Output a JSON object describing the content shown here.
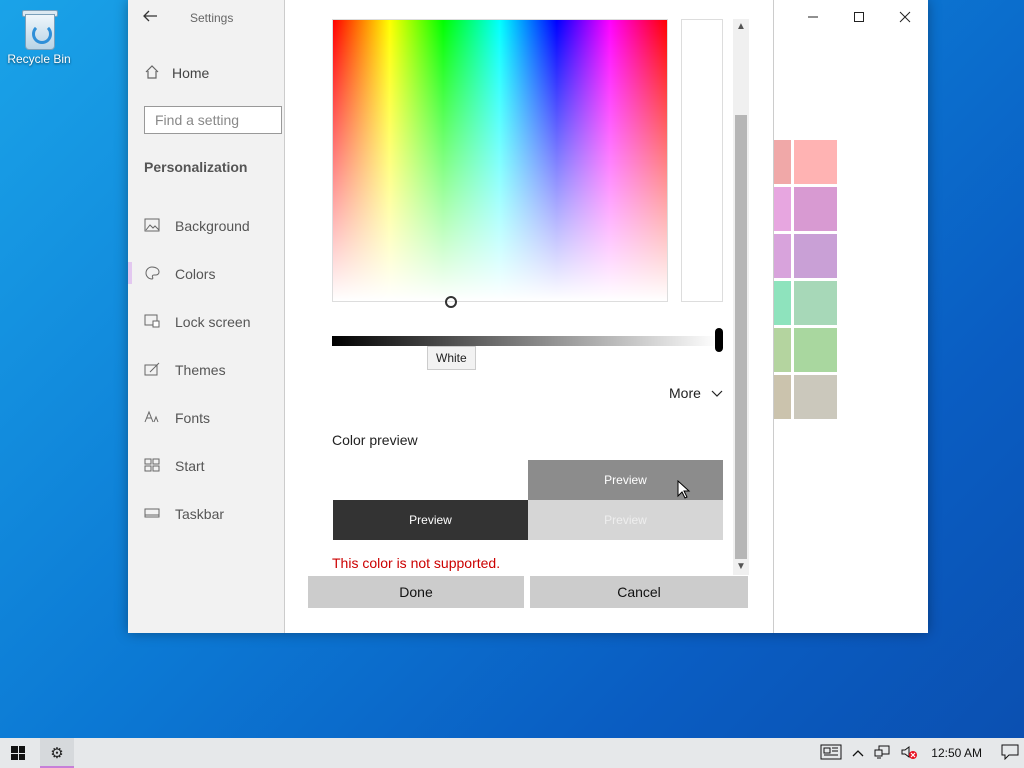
{
  "desktop": {
    "recycle_bin_label": "Recycle Bin"
  },
  "settings": {
    "app_title": "Settings",
    "home_label": "Home",
    "search_placeholder": "Find a setting",
    "section_title": "Personalization",
    "nav_items": [
      {
        "label": "Background",
        "icon": "image-icon"
      },
      {
        "label": "Colors",
        "icon": "palette-icon",
        "active": true
      },
      {
        "label": "Lock screen",
        "icon": "lock-screen-icon"
      },
      {
        "label": "Themes",
        "icon": "brush-icon"
      },
      {
        "label": "Fonts",
        "icon": "font-icon"
      },
      {
        "label": "Start",
        "icon": "start-icon"
      },
      {
        "label": "Taskbar",
        "icon": "taskbar-icon"
      }
    ],
    "swatch_colors": [
      [
        "#f0a8a8",
        "#ffb3b3"
      ],
      [
        "#e7a6e0",
        "#d89ad2"
      ],
      [
        "#d8a3dc",
        "#c9a0d6"
      ],
      [
        "#8ee3bd",
        "#a7d8b8"
      ],
      [
        "#b4d49f",
        "#a9d79f"
      ],
      [
        "#cbc3ad",
        "#cbc8bc"
      ]
    ]
  },
  "dialog": {
    "tooltip": "White",
    "more_label": "More",
    "color_preview_label": "Color preview",
    "preview_text": "Preview",
    "error_text": "This color is not supported.",
    "done_label": "Done",
    "cancel_label": "Cancel",
    "value_level": 1.0
  },
  "taskbar": {
    "clock": "12:50 AM"
  }
}
